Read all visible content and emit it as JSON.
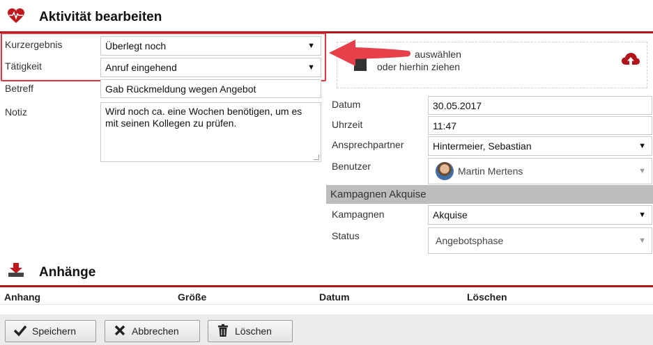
{
  "header": {
    "title": "Aktivität bearbeiten",
    "icon": "heart-pulse-icon"
  },
  "form": {
    "kurzergebnis": {
      "label": "Kurzergebnis",
      "value": "Überlegt noch"
    },
    "taetigkeit": {
      "label": "Tätigkeit",
      "value": "Anruf eingehend"
    },
    "betreff": {
      "label": "Betreff",
      "value": "Gab Rückmeldung wegen Angebot"
    },
    "notiz": {
      "label": "Notiz",
      "line1": "Wird noch ca. eine Wochen benötigen, um es",
      "line2": "mit seinen Kollegen zu prüfen."
    }
  },
  "dropzone": {
    "line1": "auswählen",
    "line2": "oder hierhin ziehen"
  },
  "details": {
    "datum": {
      "label": "Datum",
      "value": "30.05.2017"
    },
    "uhrzeit": {
      "label": "Uhrzeit",
      "value": "11:47"
    },
    "ansprechpartner": {
      "label": "Ansprechpartner",
      "value": "Hintermeier, Sebastian"
    },
    "benutzer": {
      "label": "Benutzer",
      "value": "Martin Mertens"
    }
  },
  "kampagnen_section": {
    "title": "Kampagnen Akquise",
    "kampagnen": {
      "label": "Kampagnen",
      "value": "Akquise"
    },
    "status": {
      "label": "Status",
      "value": "Angebotsphase"
    }
  },
  "attachments": {
    "title": "Anhänge",
    "columns": [
      "Anhang",
      "Größe",
      "Datum",
      "Löschen"
    ]
  },
  "buttons": {
    "save": "Speichern",
    "cancel": "Abbrechen",
    "delete": "Löschen"
  },
  "colors": {
    "accent": "#b0141a",
    "highlight": "#e0343e",
    "arrow": "#e8404a"
  }
}
